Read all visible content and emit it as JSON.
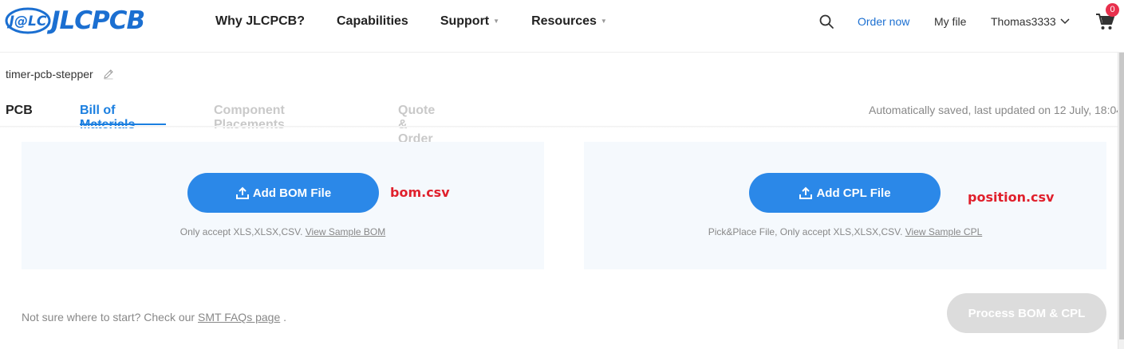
{
  "header": {
    "logo_badge": "J@LC",
    "logo_text": "JLCPCB",
    "nav": [
      {
        "label": "Why JLCPCB?",
        "has_caret": false
      },
      {
        "label": "Capabilities",
        "has_caret": false
      },
      {
        "label": "Support",
        "has_caret": true
      },
      {
        "label": "Resources",
        "has_caret": true
      }
    ],
    "search_icon": "search-icon",
    "order_now": "Order now",
    "my_file": "My file",
    "user": "Thomas3333",
    "cart_count": "0"
  },
  "project": {
    "name": "timer-pcb-stepper"
  },
  "tabs": {
    "pcb": "PCB",
    "bom": "Bill of Materials",
    "placements": "Component Placements",
    "quote": "Quote & Order",
    "active": "Bill of Materials"
  },
  "saved_status": "Automatically saved, last updated on 12 July, 18:04",
  "bom_panel": {
    "button": "Add BOM File",
    "hint_text": "Only accept XLS,XLSX,CSV.",
    "hint_link": "View Sample BOM",
    "annotation": "bom.csv"
  },
  "cpl_panel": {
    "button": "Add CPL File",
    "hint_text": "Pick&Place File, Only accept XLS,XLSX,CSV.",
    "hint_link": "View Sample CPL",
    "annotation": "position.csv"
  },
  "footer": {
    "faq_text": "Not sure where to start? Check our",
    "faq_link": "SMT FAQs page",
    "faq_suffix": ".",
    "process_button": "Process BOM & CPL",
    "process_enabled": false
  },
  "colors": {
    "brand_blue": "#1b6fd1",
    "button_blue": "#2b88e8",
    "active_tab": "#1b7fe0",
    "annotation_red": "#e0202c",
    "disabled_button": "#dcdcdc",
    "badge_red": "#e8304d"
  }
}
